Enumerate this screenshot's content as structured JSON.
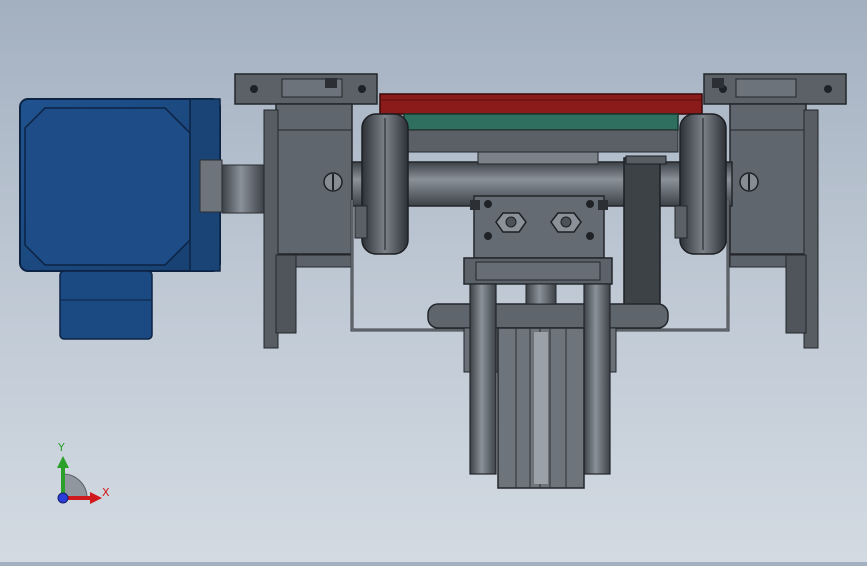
{
  "colors": {
    "background_top": "#a3b0c0",
    "background_bottom": "#d3dae2",
    "motor_body": "#1d4f8f",
    "motor_edge": "#0d2344",
    "steel": "#5f656c",
    "steel_dark": "#33373c",
    "steel_light": "#868d95",
    "plate_red": "#8b1a1a",
    "plate_green": "#2f6f5f",
    "axis_x": "#d0191c",
    "axis_y": "#2aa02a",
    "axis_z": "#2a3dd8"
  },
  "triad": {
    "x_label": "X",
    "y_label": "Y"
  }
}
